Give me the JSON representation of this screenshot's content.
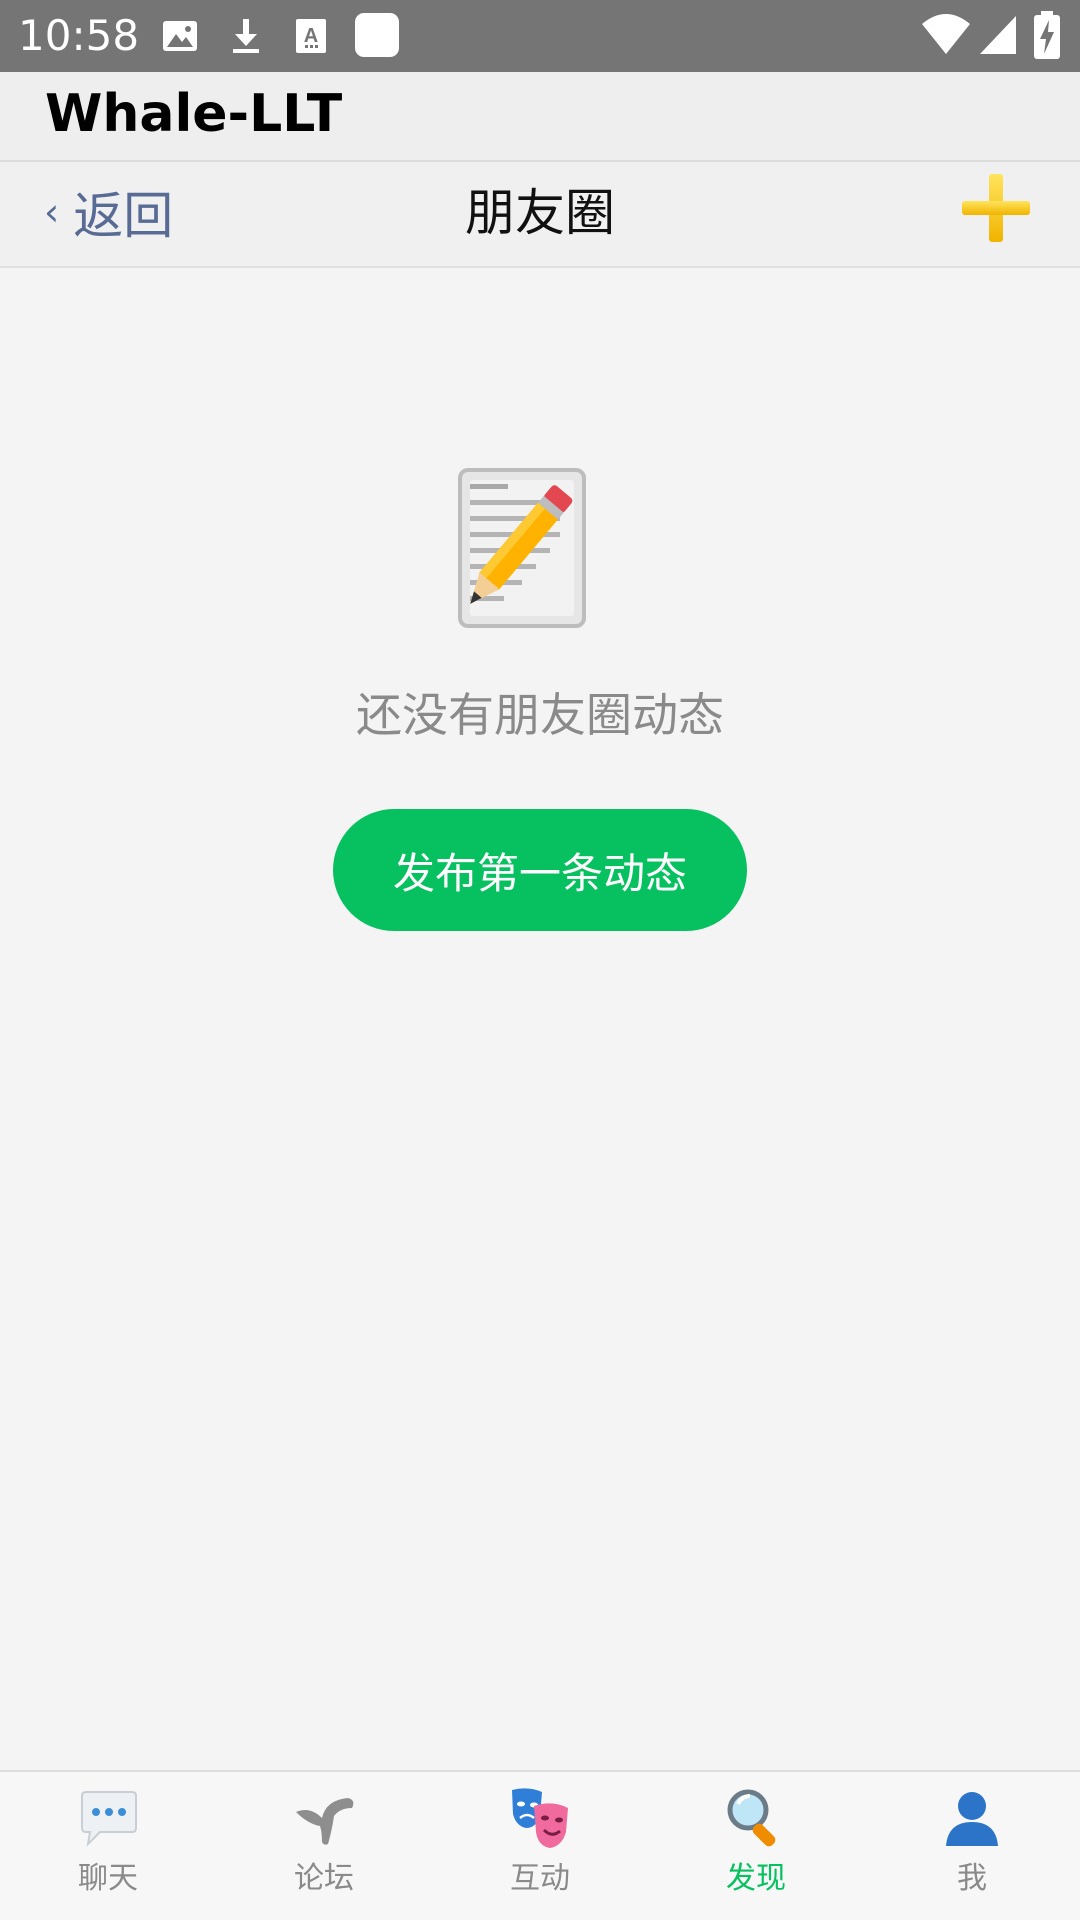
{
  "status_bar": {
    "time": "10:58",
    "icons": [
      "image-icon",
      "download-icon",
      "font-icon",
      "app-square-icon",
      "wifi-icon",
      "signal-icon",
      "battery-charging-icon"
    ]
  },
  "app": {
    "title": "Whale-LLT"
  },
  "nav": {
    "back_chevron": "‹",
    "back_label": "返回",
    "title": "朋友圈",
    "add_icon": "plus-icon"
  },
  "empty_state": {
    "icon": "memo-pencil-icon",
    "message": "还没有朋友圈动态",
    "button_label": "发布第一条动态"
  },
  "tabs": [
    {
      "label": "聊天",
      "icon": "chat-bubble-icon",
      "active": false
    },
    {
      "label": "论坛",
      "icon": "bird-icon",
      "active": false
    },
    {
      "label": "互动",
      "icon": "theater-masks-icon",
      "active": false
    },
    {
      "label": "发现",
      "icon": "magnifier-icon",
      "active": true
    },
    {
      "label": "我",
      "icon": "person-icon",
      "active": false
    }
  ],
  "colors": {
    "accent_green": "#07c160",
    "link_blue": "#576b95",
    "plus_yellow": "#f5c518",
    "status_bar_bg": "#757575"
  }
}
